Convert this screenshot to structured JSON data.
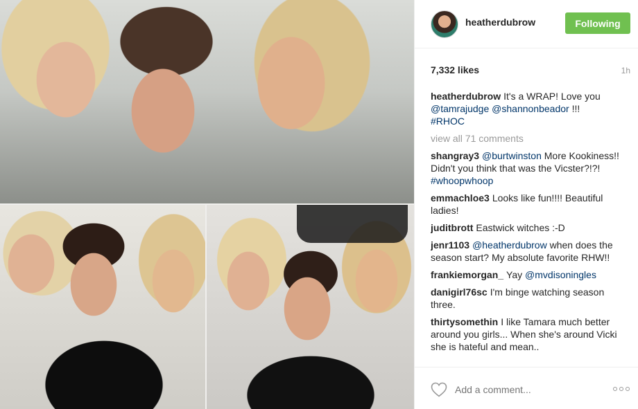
{
  "post": {
    "username": "heatherdubrow",
    "follow_label": "Following",
    "likes": "7,332 likes",
    "time": "1h"
  },
  "caption": {
    "username": "heatherdubrow",
    "text": "It's a WRAP! Love you",
    "mention_1": "@tamrajudge",
    "mention_2": "@shannonbeador",
    "suffix": "!!!",
    "hashtag": "#RHOC"
  },
  "view_all": "view all 71 comments",
  "comments": [
    {
      "username": "shangray3",
      "mention": "@burtwinston",
      "text": "More Kookiness!! Didn't you think that was the Vicster?!?!",
      "hashtag": "#whoopwhoop"
    },
    {
      "username": "emmachloe3",
      "text": "Looks like fun!!!! Beautiful ladies!"
    },
    {
      "username": "juditbrott",
      "text": "Eastwick witches :-D"
    },
    {
      "username": "jenr1103",
      "mention": "@heatherdubrow",
      "text": "when does the season start? My absolute favorite RHW!!"
    },
    {
      "username": "frankiemorgan_",
      "text": "Yay",
      "mention": "@mvdisoningles"
    },
    {
      "username": "danigirl76sc",
      "text": "I'm binge watching season three."
    },
    {
      "username": "thirtysomethin",
      "text": "I like Tamara much better around you girls... When she's around Vicki she is hateful and mean.."
    }
  ],
  "footer": {
    "placeholder": "Add a comment..."
  },
  "icons": {
    "like": "heart-icon",
    "more": "more-options-icon"
  },
  "colors": {
    "follow_button": "#70c050",
    "link": "#003569"
  }
}
